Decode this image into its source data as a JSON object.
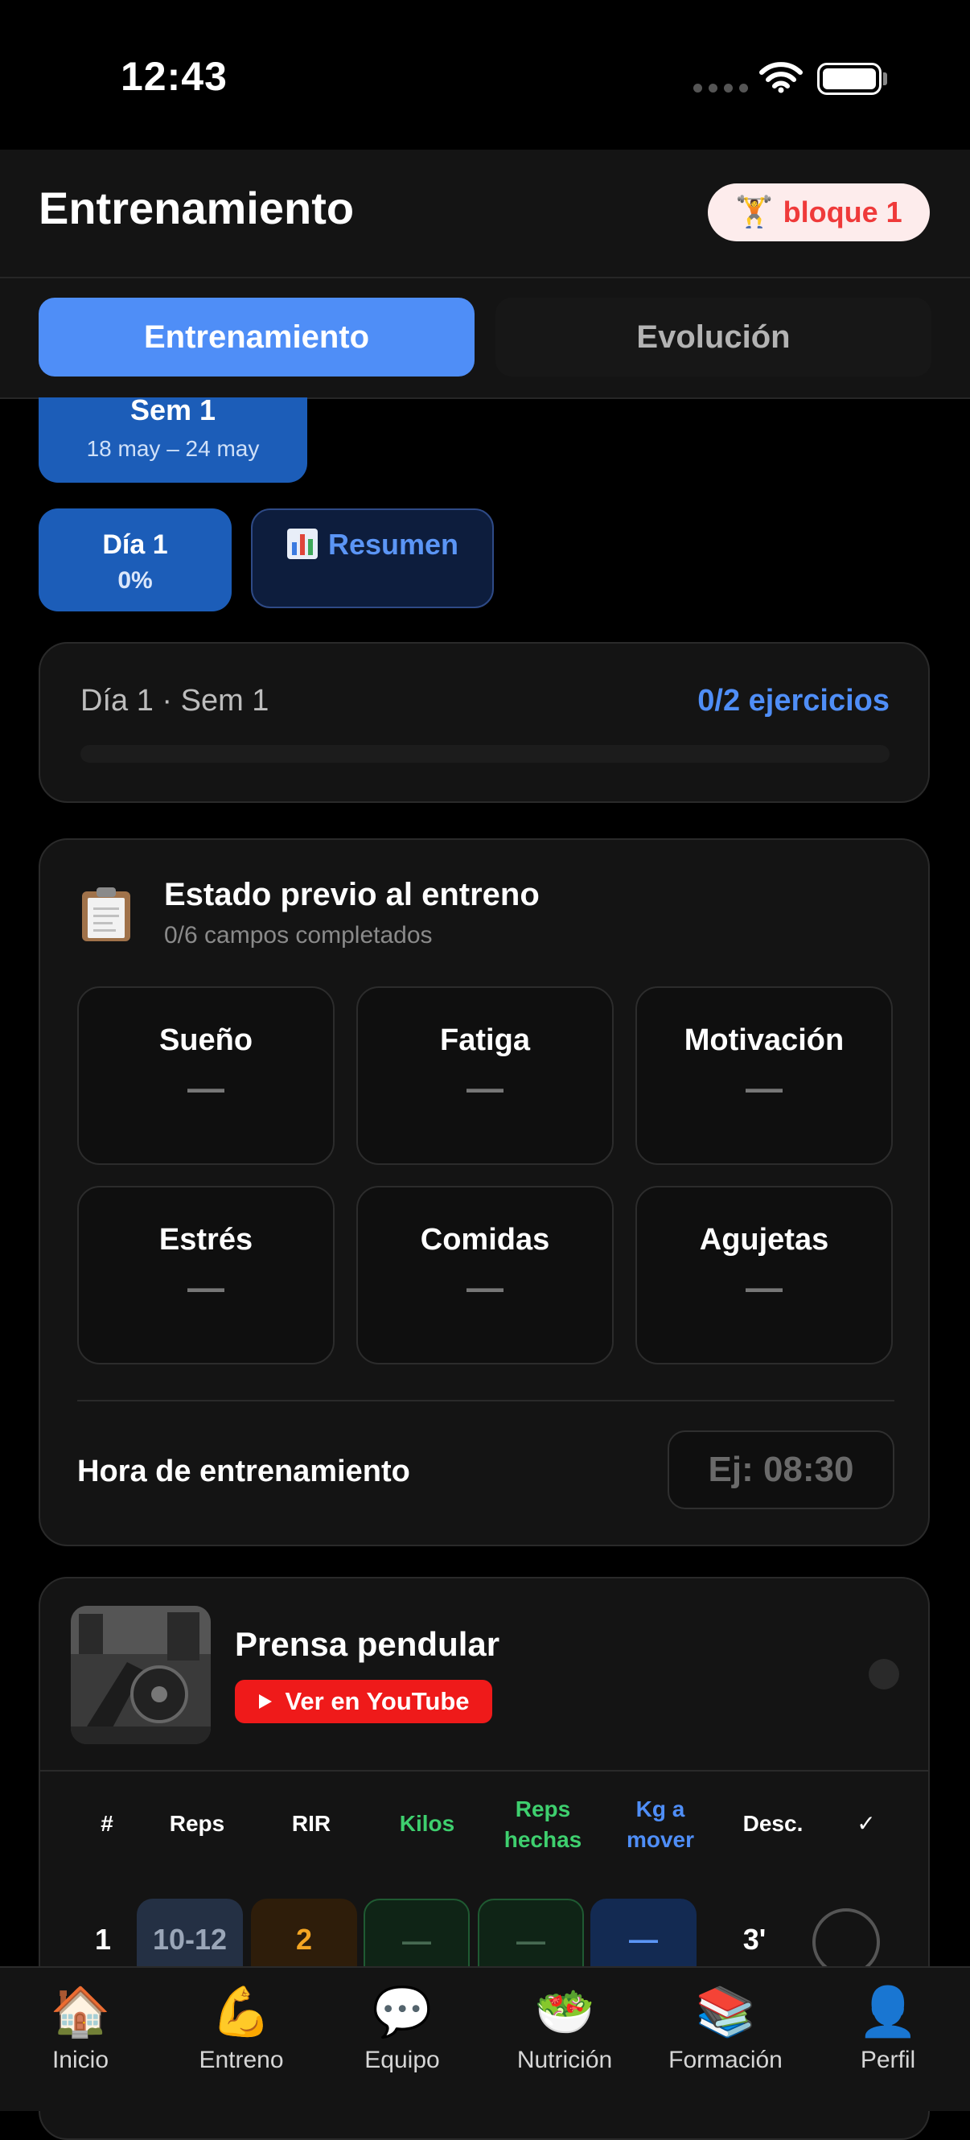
{
  "status_bar": {
    "time": "12:43"
  },
  "header": {
    "title": "Entrenamiento",
    "badge_label": "bloque 1",
    "badge_icon": "weightlifter-icon"
  },
  "tabs": [
    {
      "label": "Entrenamiento",
      "active": true
    },
    {
      "label": "Evolución",
      "active": false
    }
  ],
  "week": {
    "label": "Sem 1",
    "range": "18 may – 24 may"
  },
  "day": {
    "label": "Día 1",
    "percent": "0%"
  },
  "summary": {
    "label": "Resumen",
    "icon": "bar-chart-icon"
  },
  "progress": {
    "title": "Día 1 · Sem 1",
    "count": "0/2 ejercicios",
    "fraction": 0
  },
  "pre_training": {
    "title": "Estado previo al entreno",
    "subtitle": "0/6 campos completados",
    "metrics": [
      {
        "label": "Sueño",
        "value": "—"
      },
      {
        "label": "Fatiga",
        "value": "—"
      },
      {
        "label": "Motivación",
        "value": "—"
      },
      {
        "label": "Estrés",
        "value": "—"
      },
      {
        "label": "Comidas",
        "value": "—"
      },
      {
        "label": "Agujetas",
        "value": "—"
      }
    ],
    "time_label": "Hora de entrenamiento",
    "time_placeholder": "Ej: 08:30"
  },
  "exercise": {
    "name": "Prensa pendular",
    "youtube_label": "Ver en YouTube",
    "columns": [
      "#",
      "Reps",
      "RIR",
      "Kilos",
      "Reps hechas",
      "Kg a mover",
      "Desc.",
      "✓"
    ],
    "col_reps_done": [
      "Reps",
      "hechas"
    ],
    "col_kg_move": [
      "Kg a",
      "mover"
    ],
    "row": {
      "num": "1",
      "reps": "10-12",
      "rir": "2",
      "kilos": "—",
      "reps_done": "—",
      "kg_move": "—",
      "rest": "3'"
    },
    "colors": {
      "kilos": "#3ecf6e",
      "reps_done": "#3ecf6e",
      "kg_move": "#4f8ef7",
      "rir": "#f5a623"
    }
  },
  "nav": [
    {
      "label": "Inicio",
      "icon": "house-icon"
    },
    {
      "label": "Entreno",
      "icon": "flexed-arm-icon"
    },
    {
      "label": "Equipo",
      "icon": "speech-bubble-icon"
    },
    {
      "label": "Nutrición",
      "icon": "salad-icon"
    },
    {
      "label": "Formación",
      "icon": "books-icon"
    },
    {
      "label": "Perfil",
      "icon": "user-silhouette-icon"
    }
  ]
}
